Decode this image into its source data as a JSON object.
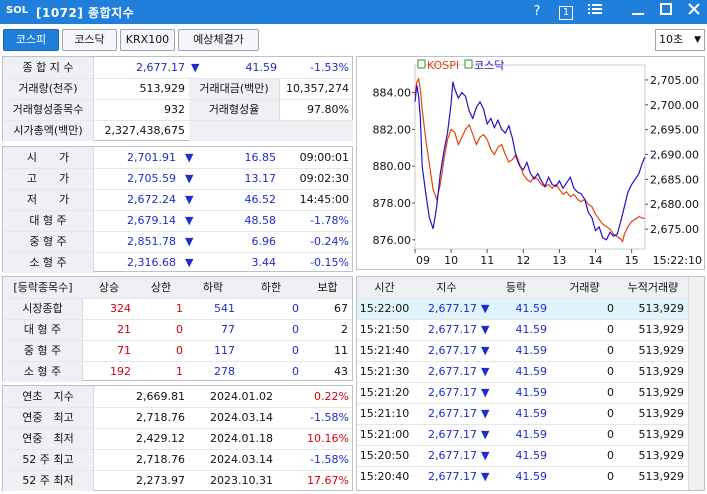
{
  "window": {
    "logo": "SOL",
    "title": "[1072] 종합지수",
    "help_label": "?",
    "link_label": "1"
  },
  "toolbar": {
    "tabs": [
      "코스피",
      "코스닥",
      "KRX100",
      "예상체결가"
    ],
    "interval": "10초"
  },
  "summary": {
    "index_label": "종 합 지 수",
    "index_value": "2,677.17",
    "change_arrow": "▼",
    "change": "41.59",
    "change_pct": "-1.53%",
    "volume_label": "거래량(천주)",
    "volume": "513,929",
    "amount_label": "거래대금(백만)",
    "amount": "10,357,274",
    "traded_label": "거래형성종목수",
    "traded": "932",
    "ratio_label": "거래형성율",
    "ratio": "97.80%",
    "mcap_label": "시가총액(백만)",
    "mcap": "2,327,438,675"
  },
  "prices": [
    {
      "label": "시　　가",
      "value": "2,701.91",
      "arrow": "▼",
      "change": "16.85",
      "info": "09:00:01"
    },
    {
      "label": "고　　가",
      "value": "2,705.59",
      "arrow": "▼",
      "change": "13.17",
      "info": "09:02:30"
    },
    {
      "label": "저　　가",
      "value": "2,672.24",
      "arrow": "▼",
      "change": "46.52",
      "info": "14:45:00"
    },
    {
      "label": "대 형 주",
      "value": "2,679.14",
      "arrow": "▼",
      "change": "48.58",
      "info": "-1.78%"
    },
    {
      "label": "중 형 주",
      "value": "2,851.78",
      "arrow": "▼",
      "change": "6.96",
      "info": "-0.24%"
    },
    {
      "label": "소 형 주",
      "value": "2,316.68",
      "arrow": "▼",
      "change": "3.44",
      "info": "-0.15%"
    }
  ],
  "breadth": {
    "headers": [
      "[등락종목수]",
      "상승",
      "상한",
      "하락",
      "하한",
      "보합"
    ],
    "rows": [
      {
        "label": "시장종합",
        "up": "324",
        "upper": "1",
        "down": "541",
        "lower": "0",
        "flat": "67"
      },
      {
        "label": "대 형 주",
        "up": "21",
        "upper": "0",
        "down": "77",
        "lower": "0",
        "flat": "2"
      },
      {
        "label": "중 형 주",
        "up": "71",
        "upper": "0",
        "down": "117",
        "lower": "0",
        "flat": "11"
      },
      {
        "label": "소 형 주",
        "up": "192",
        "upper": "1",
        "down": "278",
        "lower": "0",
        "flat": "43"
      }
    ]
  },
  "records": [
    {
      "label": "연초　지수",
      "value": "2,669.81",
      "date": "2024.01.02",
      "pct": "0.22%"
    },
    {
      "label": "연중　최고",
      "value": "2,718.76",
      "date": "2024.03.14",
      "pct": "-1.58%"
    },
    {
      "label": "연중　최저",
      "value": "2,429.12",
      "date": "2024.01.18",
      "pct": "10.16%"
    },
    {
      "label": "52 주 최고",
      "value": "2,718.76",
      "date": "2024.03.14",
      "pct": "-1.58%"
    },
    {
      "label": "52 주 최저",
      "value": "2,273.97",
      "date": "2023.10.31",
      "pct": "17.67%"
    }
  ],
  "ticks": {
    "headers": [
      "시간",
      "지수",
      "등락",
      "거래량",
      "누적거래량"
    ],
    "rows": [
      {
        "time": "15:22:00",
        "index": "2,677.17",
        "arrow": "▼",
        "change": "41.59",
        "vol": "0",
        "cum": "513,929"
      },
      {
        "time": "15:21:50",
        "index": "2,677.17",
        "arrow": "▼",
        "change": "41.59",
        "vol": "0",
        "cum": "513,929"
      },
      {
        "time": "15:21:40",
        "index": "2,677.17",
        "arrow": "▼",
        "change": "41.59",
        "vol": "0",
        "cum": "513,929"
      },
      {
        "time": "15:21:30",
        "index": "2,677.17",
        "arrow": "▼",
        "change": "41.59",
        "vol": "0",
        "cum": "513,929"
      },
      {
        "time": "15:21:20",
        "index": "2,677.17",
        "arrow": "▼",
        "change": "41.59",
        "vol": "0",
        "cum": "513,929"
      },
      {
        "time": "15:21:10",
        "index": "2,677.17",
        "arrow": "▼",
        "change": "41.59",
        "vol": "0",
        "cum": "513,929"
      },
      {
        "time": "15:21:00",
        "index": "2,677.17",
        "arrow": "▼",
        "change": "41.59",
        "vol": "0",
        "cum": "513,929"
      },
      {
        "time": "15:20:50",
        "index": "2,677.17",
        "arrow": "▼",
        "change": "41.59",
        "vol": "0",
        "cum": "513,929"
      },
      {
        "time": "15:20:40",
        "index": "2,677.17",
        "arrow": "▼",
        "change": "41.59",
        "vol": "0",
        "cum": "513,929"
      }
    ]
  },
  "chart_data": {
    "type": "line",
    "legend": [
      "KOSPI",
      "코스닥"
    ],
    "series_colors": {
      "KOSPI": "#e8420a",
      "코스닥": "#2a10c8"
    },
    "y_left_ticks": [
      "884.00",
      "882.00",
      "880.00",
      "878.00",
      "876.00"
    ],
    "y_right_ticks": [
      "2,705.00",
      "2,700.00",
      "2,695.00",
      "2,690.00",
      "2,685.00",
      "2,680.00",
      "2,675.00"
    ],
    "x_ticks": [
      "09",
      "10",
      "11",
      "12",
      "13",
      "14",
      "15"
    ],
    "x_last": "15:22:10",
    "xlim": [
      9.0,
      15.37
    ],
    "ylim_left": [
      875.5,
      885.5
    ],
    "ylim_right": [
      2671,
      2708
    ],
    "series": [
      {
        "name": "KOSPI",
        "axis": "right",
        "x": [
          9.0,
          9.05,
          9.1,
          9.15,
          9.2,
          9.3,
          9.4,
          9.5,
          9.6,
          9.7,
          9.8,
          9.9,
          10.0,
          10.1,
          10.2,
          10.3,
          10.4,
          10.5,
          10.6,
          10.7,
          10.8,
          10.9,
          11.0,
          11.1,
          11.2,
          11.3,
          11.4,
          11.5,
          11.6,
          11.7,
          11.8,
          11.9,
          12.0,
          12.1,
          12.2,
          12.3,
          12.4,
          12.5,
          12.6,
          12.7,
          12.8,
          12.9,
          13.0,
          13.1,
          13.2,
          13.3,
          13.4,
          13.5,
          13.6,
          13.7,
          13.8,
          13.9,
          14.0,
          14.1,
          14.2,
          14.3,
          14.4,
          14.5,
          14.6,
          14.7,
          14.75,
          14.8,
          14.9,
          15.0,
          15.1,
          15.2,
          15.3,
          15.37
        ],
        "y": [
          2701.9,
          2704.5,
          2705.2,
          2703,
          2699,
          2693,
          2688,
          2683,
          2681,
          2684,
          2689,
          2693,
          2695,
          2694.5,
          2692,
          2693.5,
          2695,
          2696,
          2694,
          2692,
          2693.5,
          2694,
          2693,
          2691,
          2690,
          2691.5,
          2692,
          2690,
          2688.5,
          2689,
          2690,
          2688,
          2686,
          2685,
          2684.5,
          2685.5,
          2685,
          2684,
          2683.5,
          2684,
          2683.2,
          2684,
          2683,
          2682,
          2682.5,
          2681.5,
          2682,
          2681,
          2680.5,
          2681,
          2680,
          2679.5,
          2678,
          2677,
          2676,
          2675.5,
          2675,
          2674,
          2673.5,
          2673,
          2672.5,
          2674,
          2675.5,
          2676.5,
          2677,
          2677.5,
          2677.2,
          2677.17
        ]
      },
      {
        "name": "코스닥",
        "axis": "left",
        "x": [
          9.0,
          9.05,
          9.1,
          9.15,
          9.2,
          9.3,
          9.4,
          9.5,
          9.6,
          9.7,
          9.8,
          9.9,
          10.0,
          10.05,
          10.1,
          10.2,
          10.3,
          10.4,
          10.5,
          10.6,
          10.7,
          10.8,
          10.9,
          11.0,
          11.1,
          11.2,
          11.3,
          11.4,
          11.5,
          11.6,
          11.7,
          11.8,
          11.9,
          12.0,
          12.1,
          12.2,
          12.3,
          12.4,
          12.5,
          12.6,
          12.7,
          12.8,
          12.9,
          13.0,
          13.1,
          13.2,
          13.3,
          13.4,
          13.5,
          13.6,
          13.7,
          13.8,
          13.9,
          14.0,
          14.1,
          14.2,
          14.3,
          14.4,
          14.5,
          14.6,
          14.7,
          14.8,
          14.9,
          15.0,
          15.1,
          15.2,
          15.3,
          15.37
        ],
        "y": [
          883.5,
          884.4,
          883.8,
          882.6,
          880.0,
          878.5,
          877.2,
          876.6,
          877.8,
          879.6,
          880.8,
          881.8,
          883.4,
          884.6,
          884.2,
          883.7,
          884.0,
          883.8,
          883.0,
          882.6,
          883.2,
          883.5,
          883.1,
          882.3,
          882.6,
          882.1,
          882.5,
          882.0,
          881.8,
          882.2,
          881.5,
          880.5,
          880.0,
          879.8,
          880.2,
          879.6,
          879.3,
          879.6,
          879.2,
          878.9,
          879.4,
          879.0,
          878.9,
          879.2,
          878.8,
          879.1,
          879.4,
          878.8,
          878.6,
          878.5,
          878.2,
          877.5,
          877.2,
          876.5,
          876.7,
          876.1,
          876.0,
          876.4,
          876.2,
          876.3,
          877.0,
          877.8,
          878.6,
          879.0,
          879.3,
          879.6,
          880.2,
          880.5
        ]
      }
    ]
  }
}
